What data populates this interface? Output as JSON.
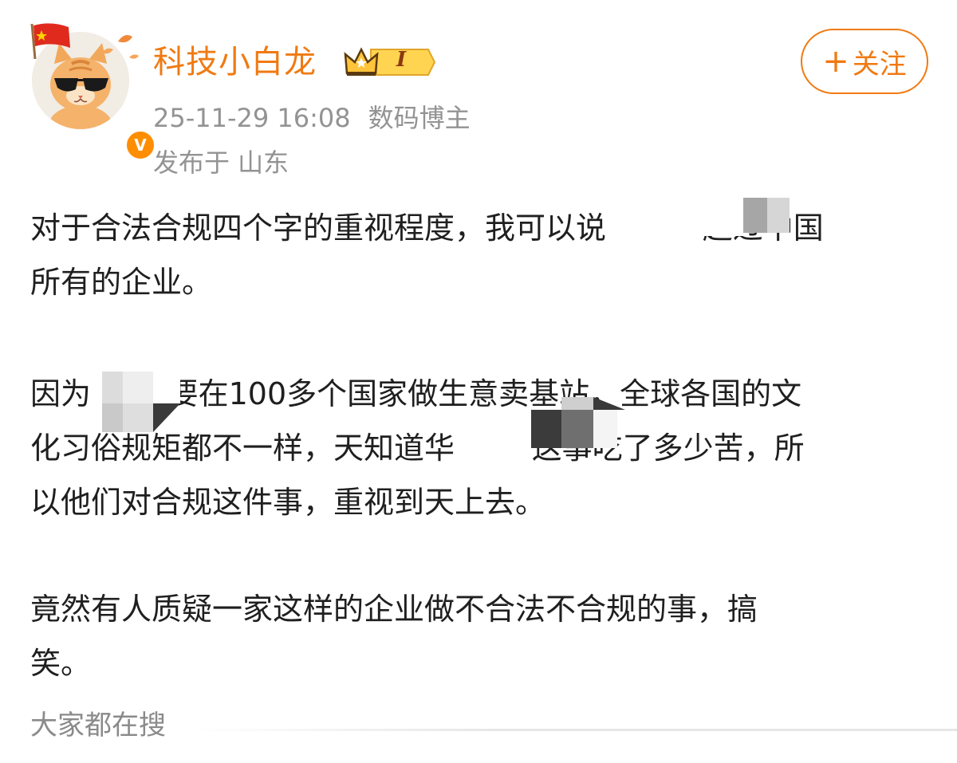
{
  "author": {
    "name": "科技小白龙",
    "level_badge": "I",
    "verified_mark": "V",
    "avatar_icon": "cat-with-sunglasses-avatar",
    "flag_icon": "china-flag-icon"
  },
  "post_meta": {
    "time": "25-11-29 16:08",
    "tag": "数码博主",
    "location": "发布于 山东"
  },
  "follow_button": {
    "plus": "+",
    "label": "关注"
  },
  "content": {
    "paragraphs": [
      "对于合法合规四个字的重视程度，我可以说          超过中国\n所有的企业。",
      "因为        要在100多个国家做生意卖基站，全球各国的文\n化习俗规矩都不一样，天知道华        这事吃了多少苦，所\n以他们对合规这件事，重视到天上去。",
      "竟然有人质疑一家这样的企业做不合法不合规的事，搞\n笑。"
    ]
  },
  "trending": {
    "label": "大家都在搜"
  },
  "colors": {
    "accent": "#f07a12",
    "meta_gray": "#939393",
    "body_text": "#1f1f1f",
    "verified_badge": "#ff8d00"
  }
}
